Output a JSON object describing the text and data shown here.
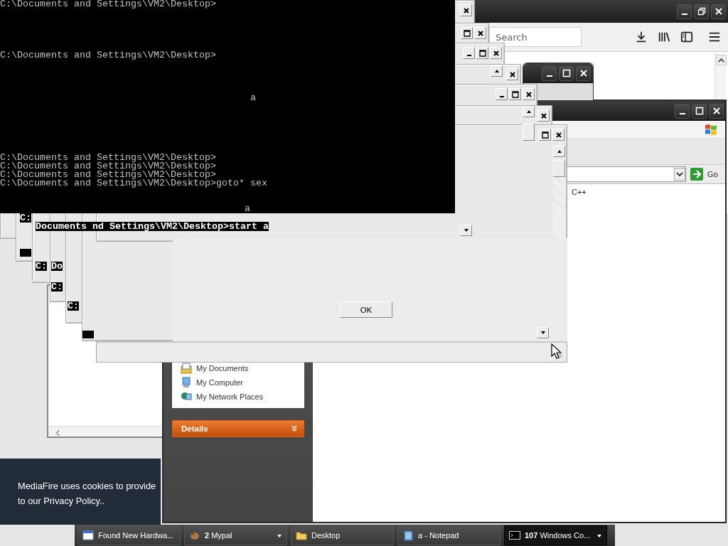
{
  "console": {
    "lines": [
      "C:\\Documents and Settings\\VM2\\Desktop>",
      "C:\\Documents and Settings\\VM2\\Desktop>",
      "a",
      "C:\\Documents and Settings\\VM2\\Desktop>",
      "C:\\Documents and Settings\\VM2\\Desktop>",
      "C:\\Documents and Settings\\VM2\\Desktop>",
      "C:\\Documents and Settings\\VM2\\Desktop>goto* sex",
      "a"
    ]
  },
  "console_fragments": [
    "C:",
    "C:",
    "Do",
    "C:",
    "C:"
  ],
  "console_selection": "Documents nd Settings\\VM2\\Desktop>start a",
  "dialog": {
    "button": "OK"
  },
  "browser": {
    "search": {
      "placeholder": "Search"
    }
  },
  "explorer": {
    "go_button": "Go",
    "content_text": "C++",
    "places": [
      {
        "label": "My Documents",
        "kind": "documents"
      },
      {
        "label": "My Computer",
        "kind": "computer"
      },
      {
        "label": "My Network Places",
        "kind": "network"
      }
    ],
    "details": {
      "title": "Details",
      "expanded": false
    }
  },
  "cookie_banner": {
    "lines": [
      "MediaFire uses cookies to provide",
      "to our Privacy Policy.."
    ]
  },
  "taskbar": {
    "items": [
      {
        "label": "Found New Hardwa...",
        "kind": "window",
        "grouped": false,
        "selected": false
      },
      {
        "label": "**2** Mypal",
        "kind": "mypal",
        "grouped": true,
        "selected": false
      },
      {
        "label": "Desktop",
        "kind": "folder",
        "grouped": false,
        "selected": false
      },
      {
        "label": "a - Notepad",
        "kind": "notepad",
        "grouped": false,
        "selected": false
      },
      {
        "label": "**107** Windows Co...",
        "kind": "console",
        "grouped": true,
        "selected": true
      }
    ]
  }
}
